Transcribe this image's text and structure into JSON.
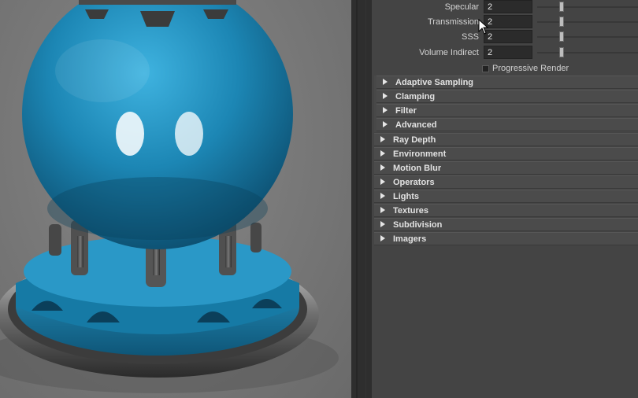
{
  "render_settings": {
    "samples": [
      {
        "label": "Specular",
        "value": "2",
        "slider": 0.2
      },
      {
        "label": "Transmission",
        "value": "2",
        "slider": 0.2
      },
      {
        "label": "SSS",
        "value": "2",
        "slider": 0.2
      },
      {
        "label": "Volume Indirect",
        "value": "2",
        "slider": 0.2
      }
    ],
    "progressive_render_label": "Progressive Render",
    "sections": [
      {
        "name": "Adaptive Sampling"
      },
      {
        "name": "Clamping"
      },
      {
        "name": "Filter"
      },
      {
        "name": "Advanced"
      },
      {
        "name": "Ray Depth"
      },
      {
        "name": "Environment"
      },
      {
        "name": "Motion Blur"
      },
      {
        "name": "Operators"
      },
      {
        "name": "Lights"
      },
      {
        "name": "Textures"
      },
      {
        "name": "Subdivision"
      },
      {
        "name": "Imagers"
      }
    ]
  },
  "colors": {
    "material_blue": "#1f86b3",
    "panel_bg": "#444444"
  }
}
